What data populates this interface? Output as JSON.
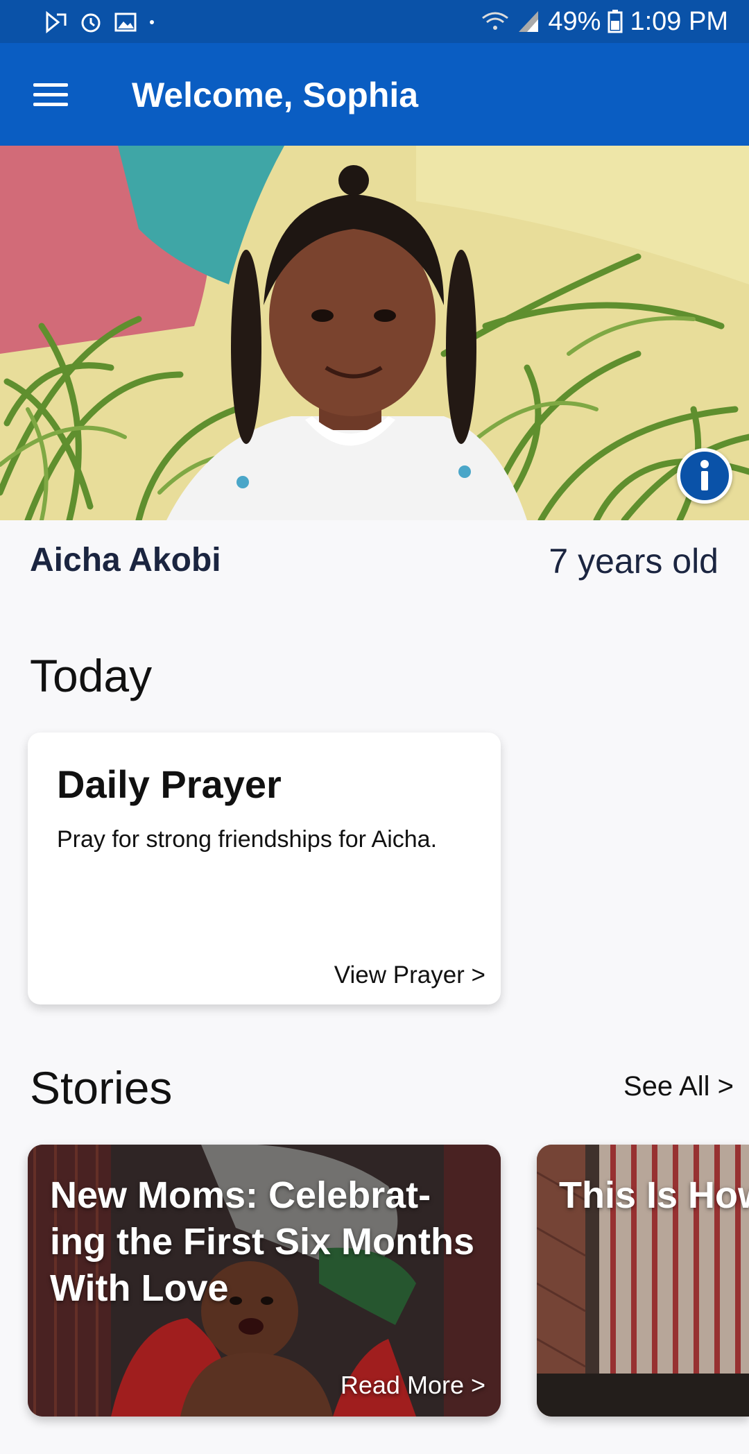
{
  "status_bar": {
    "battery": "49%",
    "time": "1:09 PM",
    "icons": [
      "play-store-notification-icon",
      "alarm-icon",
      "gallery-icon",
      "dot-icon",
      "wifi-icon",
      "signal-icon",
      "battery-icon"
    ]
  },
  "app_bar": {
    "title": "Welcome, Sophia",
    "menu_icon": "hamburger-menu-icon",
    "background_color": "#0a5dc2"
  },
  "hero": {
    "photo": "child-portrait-photo",
    "info_icon": "info-icon"
  },
  "child": {
    "name": "Aicha Akobi",
    "age": "7 years old"
  },
  "today": {
    "section_title": "Today",
    "prayer_card": {
      "title": "Daily Prayer",
      "text": "Pray for strong friendships for Aicha.",
      "link": "View Prayer >"
    }
  },
  "stories": {
    "section_title": "Stories",
    "see_all": "See All >",
    "items": [
      {
        "title": "New Moms: Celebrat-\ning the First Six Months\nWith Love",
        "link": "Read More >"
      },
      {
        "title": "This Is How\nLives With"
      }
    ]
  }
}
